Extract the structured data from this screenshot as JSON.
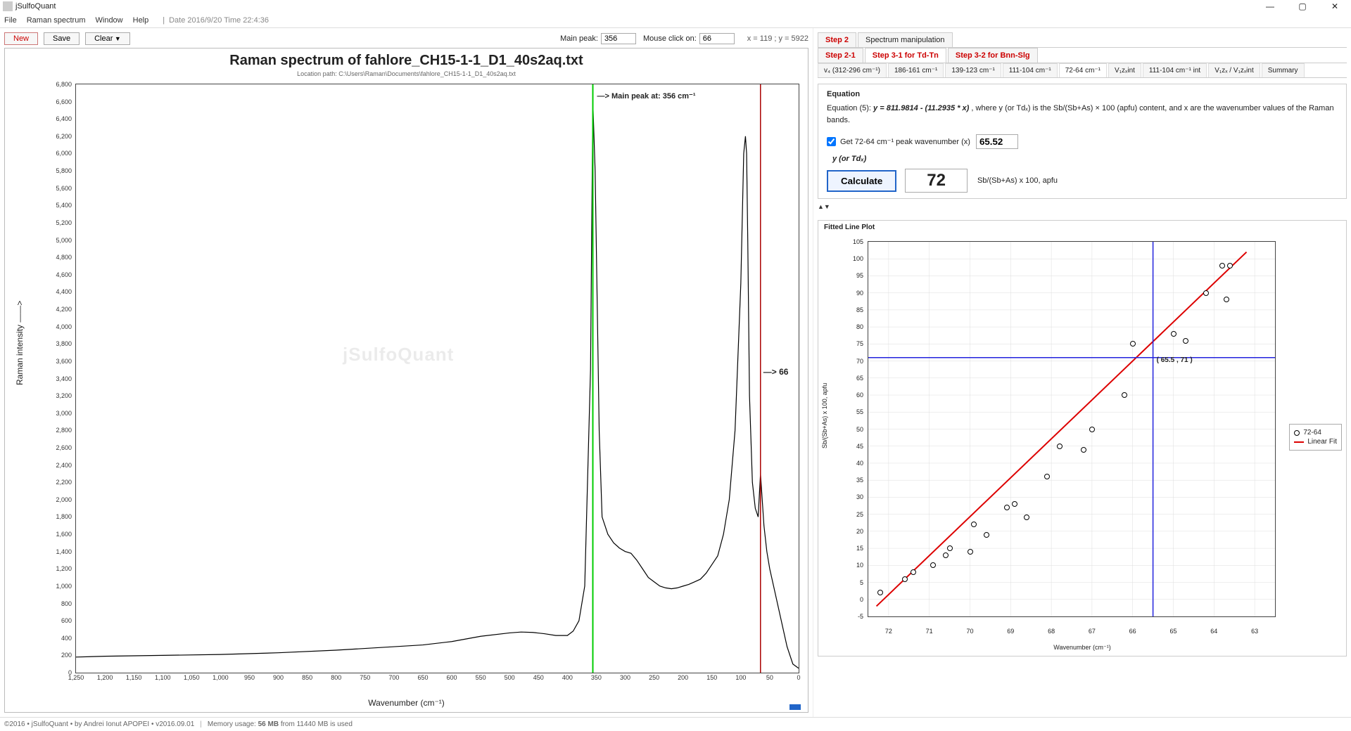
{
  "app_title": "jSulfoQuant",
  "menus": [
    "File",
    "Raman spectrum",
    "Window",
    "Help"
  ],
  "date_time": "Date 2016/9/20  Time 22:4:36",
  "toolbar": {
    "new": "New",
    "save": "Save",
    "clear": "Clear",
    "main_peak_label": "Main peak:",
    "main_peak_value": "356",
    "mouse_label": "Mouse click on:",
    "mouse_value": "66",
    "coords": "x = 119 ; y = 5922"
  },
  "chart": {
    "title": "Raman spectrum of fahlore_CH15-1-1_D1_40s2aq.txt",
    "path": "Location path: C:\\Users\\Raman\\Documents\\fahlore_CH15-1-1_D1_40s2aq.txt",
    "y_axis_label": "Raman intensity ——>",
    "x_axis_label": "Wavenumber (cm⁻¹)",
    "main_peak_annotation": "—> Main peak at: 356 cm⁻¹",
    "click_annotation": "—> 66",
    "watermark": "jSulfoQuant"
  },
  "right": {
    "step2": "Step 2",
    "step2_title": "Spectrum manipulation",
    "step21": "Step 2-1",
    "step31": "Step 3-1 for Td-Tn",
    "step32": "Step 3-2 for Bnn-Slg",
    "subtabs": [
      "v₄ (312-296 cm⁻¹)",
      "186-161 cm⁻¹",
      "139-123 cm⁻¹",
      "111-104 cm⁻¹",
      "72-64 cm⁻¹",
      "V₁zₓint",
      "111-104 cm⁻¹ int",
      "V₁zₓ / V₁zₓint",
      "Summary"
    ],
    "active_subtab_index": 4,
    "equation_heading": "Equation",
    "equation_text_prefix": "Equation (5): ",
    "equation_formula": "y = 811.9814 - (11.2935 * x)",
    "equation_suffix": ", where y (or Tdₓ) is the Sb/(Sb+As) × 100 (apfu) content, and x are the wavenumber values of the Raman bands.",
    "checkbox_label": "Get 72-64 cm⁻¹ peak wavenumber (x)",
    "x_value": "65.52",
    "y_label": "y (or Tdₓ)",
    "calc_btn": "Calculate",
    "result": "72",
    "result_unit": "Sb/(Sb+As) x 100, apfu",
    "fitted_heading": "Fitted Line Plot",
    "legend_series": "72-64",
    "legend_fit": "Linear Fit",
    "fitted_y_label": "Sb/(Sb+As) x 100, apfu",
    "fitted_x_label": "Wavenumber (cm⁻¹)",
    "crosshair_label": "( 65.5 , 71 )"
  },
  "status": {
    "copyright": "©2016 • jSulfoQuant • by Andrei Ionut APOPEI • v2016.09.01",
    "memory_label": "Memory usage:",
    "memory_value": "56 MB",
    "memory_suffix": "from 11440 MB is used"
  },
  "chart_data": [
    {
      "type": "line",
      "name": "raman-spectrum",
      "x_axis_label": "Wavenumber (cm⁻¹)",
      "y_axis_label": "Raman intensity",
      "xlim": [
        1250,
        0
      ],
      "ylim": [
        0,
        6800
      ],
      "main_peak_x": 356,
      "click_marker_x": 66,
      "x": [
        1250,
        1200,
        1100,
        1000,
        900,
        800,
        700,
        650,
        600,
        550,
        500,
        480,
        460,
        440,
        420,
        400,
        390,
        380,
        370,
        360,
        356,
        352,
        345,
        340,
        330,
        320,
        310,
        300,
        290,
        280,
        270,
        260,
        250,
        240,
        230,
        220,
        210,
        200,
        190,
        180,
        170,
        160,
        150,
        140,
        130,
        120,
        110,
        100,
        95,
        92,
        90,
        88,
        85,
        80,
        75,
        70,
        66,
        60,
        55,
        50,
        40,
        30,
        20,
        10,
        0
      ],
      "y": [
        180,
        190,
        200,
        210,
        230,
        260,
        300,
        320,
        360,
        420,
        460,
        470,
        465,
        450,
        430,
        430,
        480,
        600,
        1000,
        3500,
        6600,
        5800,
        2800,
        1800,
        1600,
        1500,
        1440,
        1400,
        1380,
        1300,
        1200,
        1100,
        1050,
        1000,
        980,
        970,
        980,
        1000,
        1020,
        1050,
        1080,
        1150,
        1250,
        1350,
        1600,
        2000,
        2800,
        4500,
        6000,
        6200,
        6000,
        5000,
        3200,
        2200,
        1900,
        1800,
        2300,
        1700,
        1400,
        1200,
        900,
        600,
        300,
        100,
        50
      ]
    },
    {
      "type": "scatter",
      "name": "fitted-line-plot",
      "title": "Fitted Line Plot",
      "x_axis_label": "Wavenumber (cm⁻¹)",
      "y_axis_label": "Sb/(Sb+As) x 100, apfu",
      "xlim": [
        72.5,
        62.5
      ],
      "ylim": [
        -5,
        105
      ],
      "x": [
        72.2,
        71.6,
        71.4,
        70.9,
        70.6,
        70.5,
        70.0,
        69.9,
        69.6,
        69.1,
        68.9,
        68.6,
        68.1,
        67.8,
        67.2,
        67.0,
        66.2,
        66.0,
        65.0,
        64.7,
        64.2,
        63.8,
        63.6,
        63.7
      ],
      "y": [
        2,
        6,
        8,
        10,
        13,
        15,
        14,
        22,
        19,
        27,
        28,
        24,
        36,
        45,
        44,
        50,
        60,
        75,
        78,
        76,
        90,
        98,
        98,
        88
      ],
      "fit_line": {
        "x1": 72.3,
        "y1": -2,
        "x2": 63.2,
        "y2": 102
      },
      "crosshair": {
        "x": 65.5,
        "y": 71
      }
    }
  ]
}
